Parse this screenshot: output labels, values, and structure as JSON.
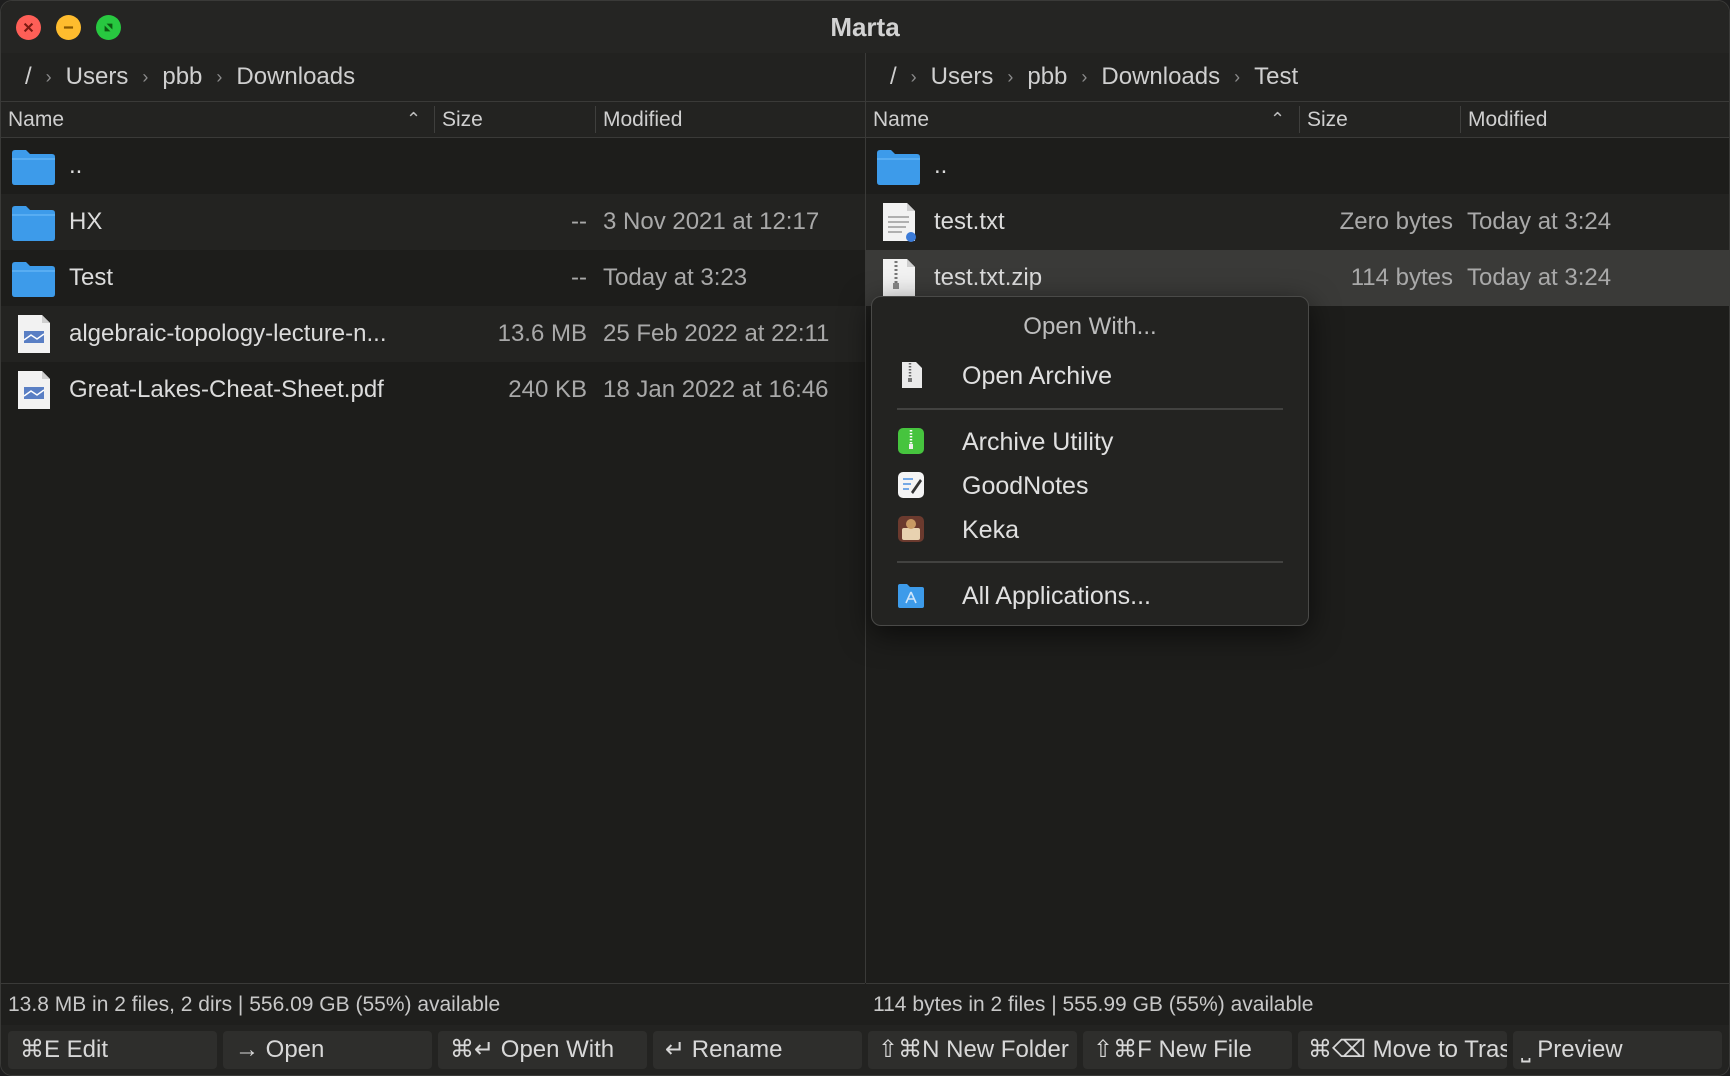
{
  "window": {
    "title": "Marta"
  },
  "left_pane": {
    "breadcrumb": [
      "/",
      "Users",
      "pbb",
      "Downloads"
    ],
    "columns": {
      "name": "Name",
      "size": "Size",
      "modified": "Modified"
    },
    "rows": [
      {
        "name": "..",
        "size": "",
        "modified": "",
        "icon": "folder-icon"
      },
      {
        "name": "HX",
        "size": "--",
        "modified": "3 Nov 2021 at 12:17",
        "icon": "folder-icon"
      },
      {
        "name": "Test",
        "size": "--",
        "modified": "Today at 3:23",
        "icon": "folder-icon"
      },
      {
        "name": "algebraic-topology-lecture-n...",
        "size": "13.6 MB",
        "modified": "25 Feb 2022 at 22:11",
        "icon": "pdf-file-icon"
      },
      {
        "name": "Great-Lakes-Cheat-Sheet.pdf",
        "size": "240 KB",
        "modified": "18 Jan 2022 at 16:46",
        "icon": "pdf-file-icon"
      }
    ],
    "status": "13.8 MB in 2 files, 2 dirs  |  556.09 GB (55%) available"
  },
  "right_pane": {
    "breadcrumb": [
      "/",
      "Users",
      "pbb",
      "Downloads",
      "Test"
    ],
    "columns": {
      "name": "Name",
      "size": "Size",
      "modified": "Modified"
    },
    "rows": [
      {
        "name": "..",
        "size": "",
        "modified": "",
        "icon": "folder-icon"
      },
      {
        "name": "test.txt",
        "size": "Zero bytes",
        "modified": "Today at 3:24",
        "icon": "text-file-icon"
      },
      {
        "name": "test.txt.zip",
        "size": "114 bytes",
        "modified": "Today at 3:24",
        "icon": "zip-file-icon"
      }
    ],
    "status": "114 bytes in 2 files  |  555.99 GB (55%) available"
  },
  "context_menu": {
    "title": "Open With...",
    "items": [
      {
        "label": "Open Archive",
        "icon": "archive-icon"
      },
      {
        "label": "Archive Utility",
        "icon": "archive-utility-icon"
      },
      {
        "label": "GoodNotes",
        "icon": "goodnotes-icon"
      },
      {
        "label": "Keka",
        "icon": "keka-icon"
      },
      {
        "label": "All Applications...",
        "icon": "applications-folder-icon"
      }
    ]
  },
  "toolbar": {
    "edit": "⌘E Edit",
    "open": "→ Open",
    "open_with": "⌘↵ Open With",
    "rename": "↵ Rename",
    "new_folder": "⇧⌘N New Folder",
    "new_file": "⇧⌘F New File",
    "move_to_trash": "⌘⌫ Move to Trash",
    "preview": "⎵ Preview"
  },
  "colors": {
    "folder": "#3d9bea",
    "close": "#fe5f57",
    "minimize": "#febc2e",
    "maximize": "#28c840"
  }
}
